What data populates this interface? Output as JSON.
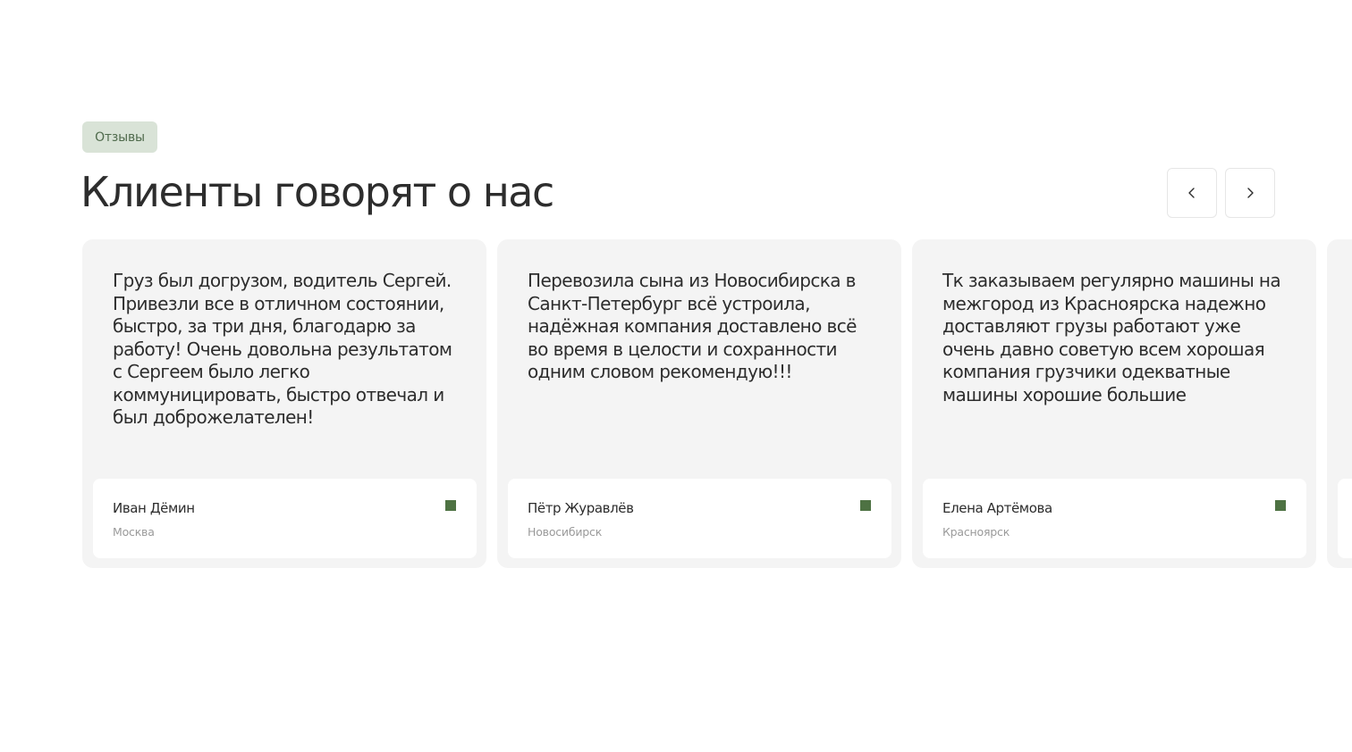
{
  "section": {
    "badge": "Отзывы",
    "title": "Клиенты говорят о нас"
  },
  "nav": {
    "prev_icon": "chevron-left-icon",
    "next_icon": "chevron-right-icon"
  },
  "colors": {
    "accent": "#4e7243",
    "badge_bg": "#d9e3d7",
    "card_bg": "#f4f4f4"
  },
  "reviews": [
    {
      "text": "Груз был догрузом, водитель Сергей. Привезли все в отличном состоянии, быстро, за три дня, благодарю за работу! Очень довольна результатом с Сергеем было легко коммуницировать, быстро отвечал и был доброжелателен!",
      "name": "Иван Дёмин",
      "city": "Москва"
    },
    {
      "text": "Перевозила сына из Новосибирска в Санкт-Петербург всё устроила, надёжная компания доставлено всё во время в целости и сохранности одним словом рекомендую!!!",
      "name": "Пётр Журавлёв",
      "city": "Новосибирск"
    },
    {
      "text": "Тк заказываем регулярно машины на межгород из Красноярска надежно доставляют грузы работают уже очень давно советую всем хорошая компания грузчики одекватные машины хорошие большие",
      "name": "Елена Артёмова",
      "city": "Красноярск"
    }
  ]
}
